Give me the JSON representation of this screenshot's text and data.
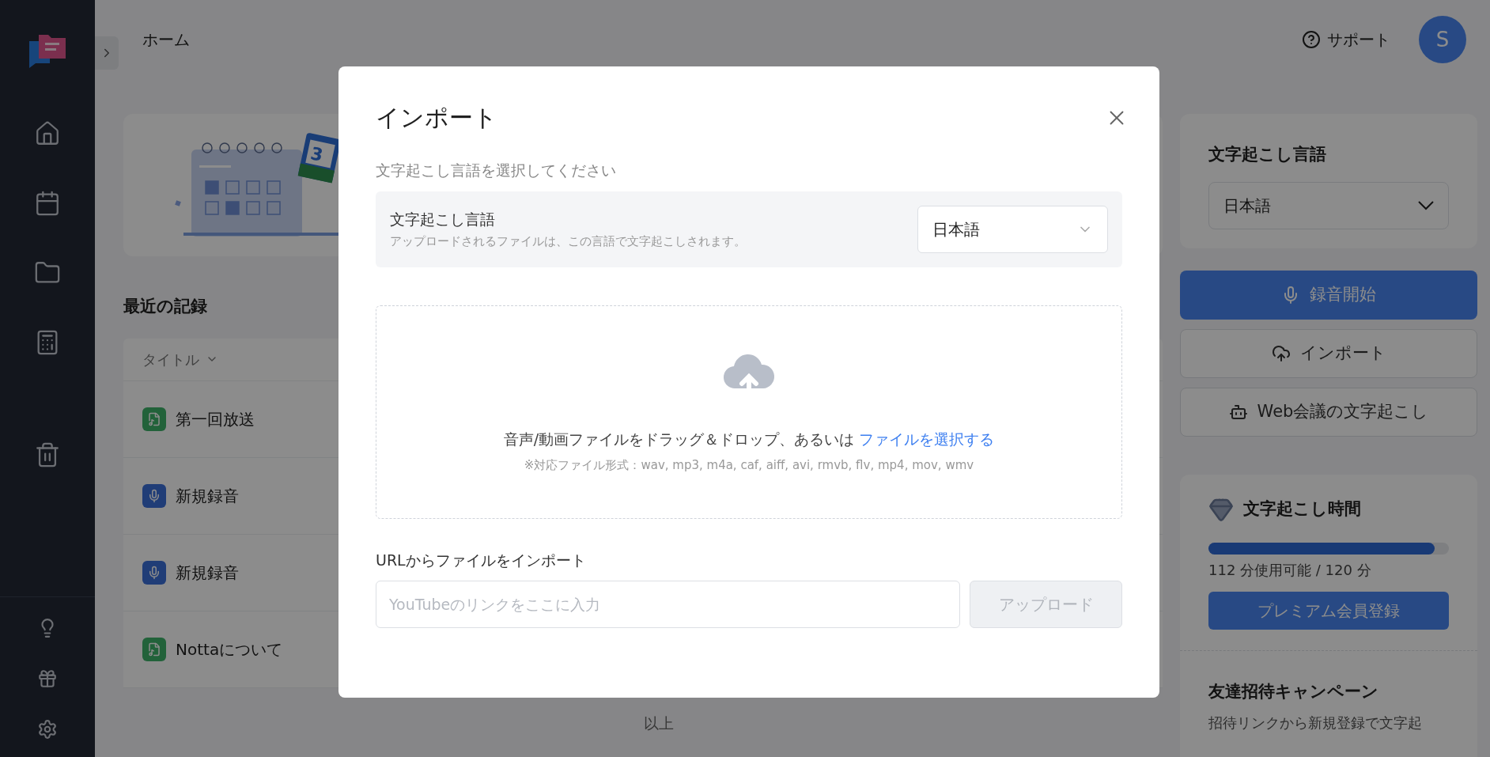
{
  "header": {
    "title": "ホーム",
    "support": "サポート",
    "avatar": "S"
  },
  "banner": {
    "calendar_badge": "3"
  },
  "recent": {
    "heading": "最近の記録",
    "column": "タイトル",
    "rows": [
      {
        "title": "第一回放送",
        "kind": "audio"
      },
      {
        "title": "新規録音",
        "kind": "recording"
      },
      {
        "title": "新規録音",
        "kind": "recording"
      },
      {
        "title": "Nottaについて",
        "kind": "audio"
      }
    ],
    "footer": "以上"
  },
  "right": {
    "language": {
      "heading": "文字起こし言語",
      "value": "日本語"
    },
    "actions": [
      {
        "label": "録音開始",
        "kind": "record"
      },
      {
        "label": "インポート",
        "kind": "import"
      },
      {
        "label": "Web会議の文字起こし",
        "kind": "meeting"
      }
    ],
    "time": {
      "heading": "文字起こし時間",
      "level": 0.94,
      "usage": "112 分使用可能 / 120 分",
      "button": "プレミアム会員登録"
    },
    "invite": {
      "heading": "友達招待キャンペーン",
      "text": "招待リンクから新規登録で文字起"
    }
  },
  "dialog": {
    "title": "インポート",
    "prompt": "文字起こし言語を選択してください",
    "language": {
      "label": "文字起こし言語",
      "hint": "アップロードされるファイルは、この言語で文字起こしされます。",
      "value": "日本語"
    },
    "dropzone": {
      "text": "音声/動画ファイルをドラッグ＆ドロップ、あるいは",
      "link": "ファイルを選択する",
      "formats": "※対応ファイル形式：wav, mp3, m4a, caf, aiff, avi, rmvb, flv, mp4, mov, wmv"
    },
    "url": {
      "label": "URLからファイルをインポート",
      "placeholder": "YouTubeのリンクをここに入力",
      "button": "アップロード",
      "disabled": true
    }
  }
}
